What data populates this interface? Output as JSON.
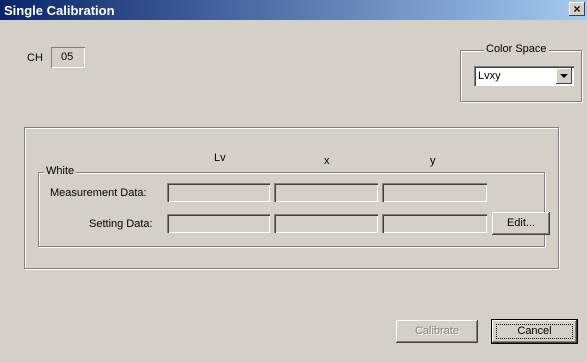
{
  "window": {
    "title": "Single Calibration",
    "close_glyph": "×"
  },
  "channel": {
    "label": "CH",
    "value": "05"
  },
  "color_space": {
    "group_label": "Color Space",
    "selected": "Lvxy"
  },
  "columns": [
    "Lv",
    "x",
    "y"
  ],
  "white_group": {
    "label": "White",
    "rows": [
      {
        "label": "Measurement Data:",
        "values": [
          "",
          "",
          ""
        ]
      },
      {
        "label": "Setting Data:",
        "values": [
          "",
          "",
          ""
        ]
      }
    ],
    "edit_label": "Edit..."
  },
  "buttons": {
    "calibrate": "Calibrate",
    "cancel": "Cancel"
  }
}
